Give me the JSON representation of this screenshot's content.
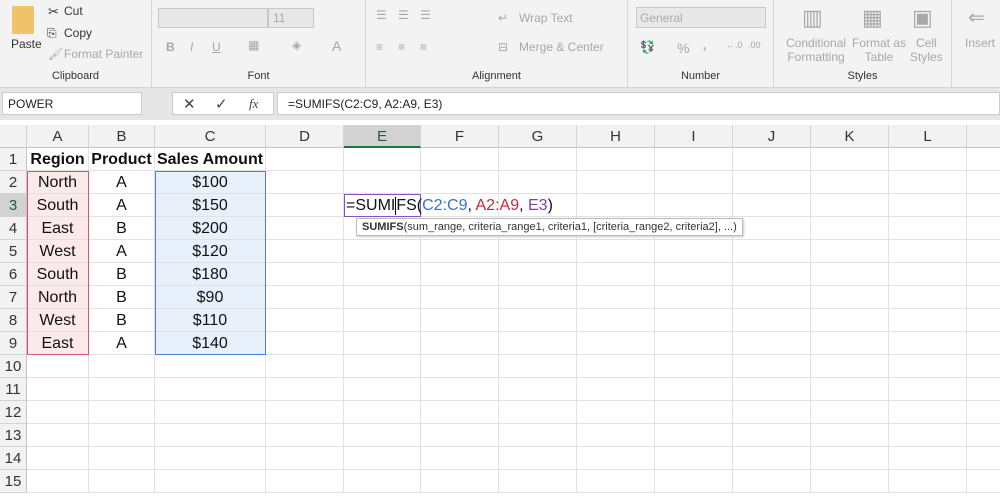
{
  "ribbon": {
    "clipboard": {
      "paste": "Paste",
      "cut": "Cut",
      "copy": "Copy",
      "format_painter": "Format Painter",
      "label": "Clipboard"
    },
    "font": {
      "font_name": "",
      "font_size": "11",
      "bold": "B",
      "italic": "I",
      "underline": "U",
      "font_color": "A",
      "label": "Font"
    },
    "alignment": {
      "wrap_text": "Wrap Text",
      "merge_center": "Merge & Center",
      "label": "Alignment"
    },
    "number": {
      "format": "General",
      "percent": "%",
      "comma": ",",
      "label": "Number"
    },
    "styles": {
      "conditional": "Conditional",
      "conditional2": "Formatting",
      "format_as": "Format as",
      "format_as2": "Table",
      "cell": "Cell",
      "cell2": "Styles",
      "label": "Styles"
    },
    "cells": {
      "insert": "Insert"
    }
  },
  "formula_bar": {
    "name_box": "POWER",
    "fx": "fx",
    "formula": "=SUMIFS(C2:C9, A2:A9, E3)"
  },
  "columns": [
    "A",
    "B",
    "C",
    "D",
    "E",
    "F",
    "G",
    "H",
    "I",
    "J",
    "K",
    "L"
  ],
  "rows": [
    "1",
    "2",
    "3",
    "4",
    "5",
    "6",
    "7",
    "8",
    "9",
    "10",
    "11",
    "12",
    "13",
    "14",
    "15"
  ],
  "table": {
    "headers": [
      "Region",
      "Product",
      "Sales Amount"
    ],
    "data": [
      [
        "North",
        "A",
        "$100"
      ],
      [
        "South",
        "A",
        "$150"
      ],
      [
        "East",
        "B",
        "$200"
      ],
      [
        "West",
        "A",
        "$120"
      ],
      [
        "South",
        "B",
        "$180"
      ],
      [
        "North",
        "B",
        "$90"
      ],
      [
        "West",
        "B",
        "$110"
      ],
      [
        "East",
        "A",
        "$140"
      ]
    ]
  },
  "edit_cell": {
    "prefix": "=SUMI",
    "rest": "FS(",
    "arg1": "C2:C9",
    "sep1": ", ",
    "arg2": "A2:A9",
    "sep2": ", ",
    "arg3": "E3",
    "close": ")"
  },
  "tooltip": {
    "fn": "SUMIFS",
    "args": "(sum_range, criteria_range1, criteria1, [criteria_range2, criteria2], ...)"
  },
  "colors": {
    "arg1": "#3b6fd4",
    "arg2": "#c8283c",
    "arg3": "#7e3fae",
    "active": "#217346"
  }
}
